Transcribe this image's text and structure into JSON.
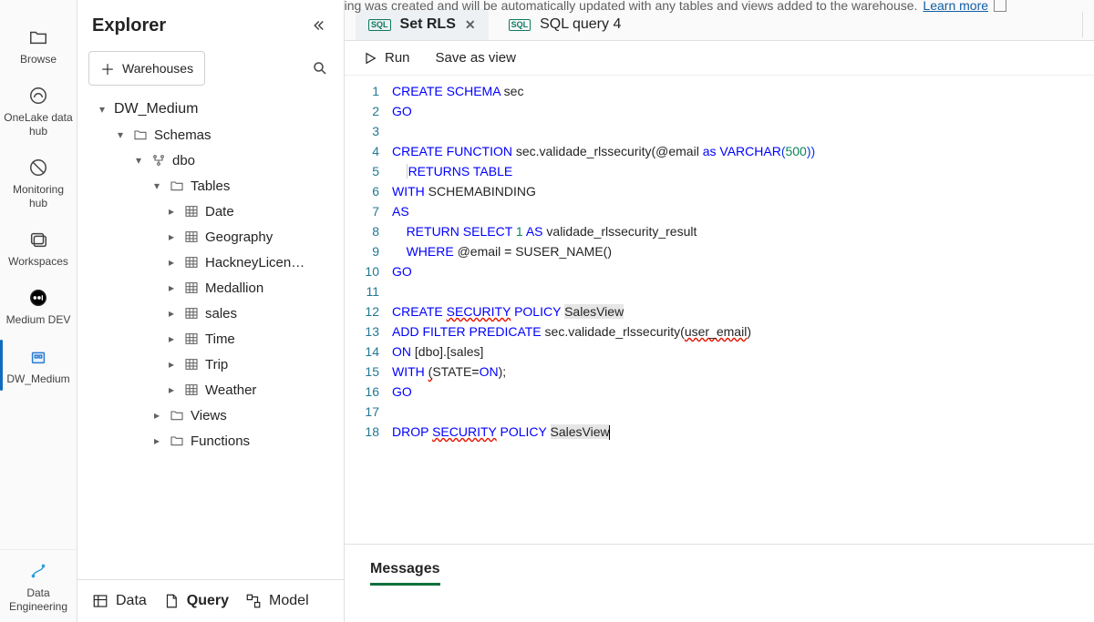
{
  "banner": {
    "text": "A default Power BI dataset for faster reporting was created and will be automatically updated with any tables and views added to the warehouse.",
    "link": "Learn more"
  },
  "rail": {
    "items": [
      {
        "label": "Browse",
        "icon": "folder",
        "active": false
      },
      {
        "label": "OneLake data hub",
        "icon": "onelake",
        "active": false
      },
      {
        "label": "Monitoring hub",
        "icon": "monitor",
        "active": false
      },
      {
        "label": "Workspaces",
        "icon": "workspaces",
        "active": false
      },
      {
        "label": "Medium DEV",
        "icon": "medium",
        "active": false
      },
      {
        "label": "DW_Medium",
        "icon": "warehouse-blue",
        "active": true
      }
    ],
    "bottom": {
      "label": "Data Engineering",
      "icon": "data-eng"
    }
  },
  "explorer": {
    "title": "Explorer",
    "warehouses_btn": "Warehouses",
    "tree": {
      "root": "DW_Medium",
      "schemas_label": "Schemas",
      "schema": "dbo",
      "tables_label": "Tables",
      "tables": [
        "Date",
        "Geography",
        "HackneyLicen…",
        "Medallion",
        "sales",
        "Time",
        "Trip",
        "Weather"
      ],
      "views_label": "Views",
      "functions_label": "Functions"
    },
    "footer": {
      "data": "Data",
      "query": "Query",
      "model": "Model"
    }
  },
  "tabs": {
    "active": {
      "label": "Set RLS"
    },
    "other": {
      "label": "SQL query 4"
    }
  },
  "actions": {
    "run": "Run",
    "save": "Save as view"
  },
  "code_tokens": {
    "l1": {
      "a": "CREATE",
      "b": "SCHEMA",
      "c": "sec"
    },
    "l2": {
      "a": "GO"
    },
    "l4": {
      "a": "CREATE",
      "b": "FUNCTION",
      "c": "sec.validade_rlssecurity(@email ",
      "d": "as",
      "e": "VARCHAR",
      "f": "(",
      "g": "500",
      "h": "))"
    },
    "l5": {
      "a": "RETURNS",
      "b": "TABLE"
    },
    "l6": {
      "a": "WITH",
      "b": "SCHEMABINDING"
    },
    "l7": {
      "a": "AS"
    },
    "l8": {
      "a": "RETURN",
      "b": "SELECT",
      "c": "1",
      "d": "AS",
      "e": "validade_rlssecurity_result"
    },
    "l9": {
      "a": "WHERE",
      "b": "@email ",
      "c": "=",
      "d": " SUSER_NAME()"
    },
    "l10": {
      "a": "GO"
    },
    "l12": {
      "a": "CREATE",
      "b": "SECURITY",
      "c": "POLICY",
      "d": "SalesView"
    },
    "l13": {
      "a": "ADD",
      "b": "FILTER",
      "c": "PREDICATE",
      "d": "sec.validade_rlssecurity(",
      "e": "user_email",
      "f": ")"
    },
    "l14": {
      "a": "ON",
      "b": "[dbo].[sales]"
    },
    "l15": {
      "a": "WITH",
      "b": "(",
      "c": "STATE",
      "d": "=",
      "e": "ON",
      "f": ");"
    },
    "l16": {
      "a": "GO"
    },
    "l18": {
      "a": "DROP",
      "b": "SECURITY",
      "c": "POLICY",
      "d": "SalesView"
    }
  },
  "line_numbers": [
    "1",
    "2",
    "3",
    "4",
    "5",
    "6",
    "7",
    "8",
    "9",
    "10",
    "11",
    "12",
    "13",
    "14",
    "15",
    "16",
    "17",
    "18"
  ],
  "messages": {
    "tab": "Messages"
  }
}
